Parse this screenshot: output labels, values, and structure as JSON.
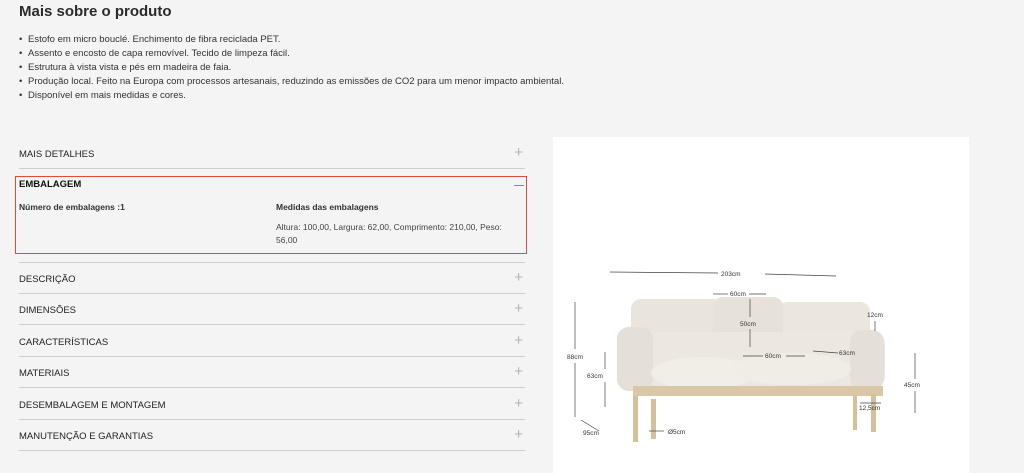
{
  "section": {
    "title": "Mais sobre o produto",
    "bullets": [
      "Estofo em micro bouclé. Enchimento de fibra reciclada PET.",
      "Assento e encosto de capa removível. Tecido de limpeza fácil.",
      "Estrutura à vista vista e pés em madeira de faia.",
      "Produção local. Feito na Europa com processos artesanais, reduzindo as emissões de CO2 para um menor impacto ambiental.",
      "Disponível em mais medidas e cores."
    ]
  },
  "accordion": {
    "mais_detalhes": "MAIS DETALHES",
    "embalagem": {
      "title": "EMBALAGEM",
      "count_label": "Número de embalagens :1",
      "measures_label": "Medidas das embalagens",
      "measures_text_1": "Altura: 100,00, Largura: 62,00, Comprimento: 210,00, Peso:",
      "measures_text_2": "56,00"
    },
    "items": [
      "DESCRIÇÃO",
      "DIMENSÕES",
      "CARACTERÍSTICAS",
      "MATERIAIS",
      "DESEMBALAGEM E MONTAGEM",
      "MANUTENÇÃO E GARANTIAS"
    ],
    "plus_icon": "+"
  },
  "dimensions": {
    "width": "203cm",
    "cushion_width": "60cm",
    "back_height": "50cm",
    "arm_top": "12cm",
    "total_height": "88cm",
    "seat_width": "60cm",
    "seat_depth": "63cm",
    "seat_height": "63cm",
    "arm_height": "45cm",
    "leg_height": "12,5cm",
    "depth": "95cm",
    "leg_diameter": "Ø5cm"
  }
}
